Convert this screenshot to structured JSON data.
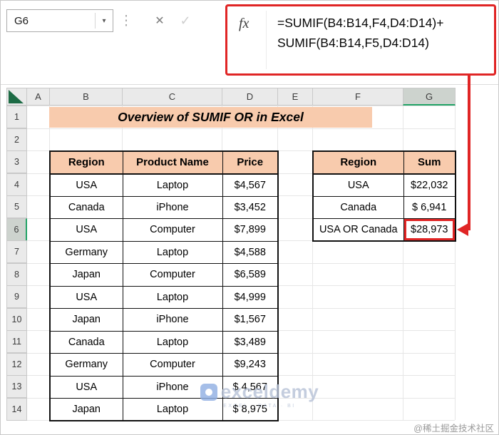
{
  "window": {
    "selected_cell": "G6"
  },
  "formula_bar": {
    "name_box_value": "G6",
    "name_box_caret": "▾",
    "handle_icon": "⋮",
    "cancel_icon": "✕",
    "enter_icon": "✓",
    "fx_label": "fx",
    "formula_line1": "=SUMIF(B4:B14,F4,D4:D14)+",
    "formula_line2": "SUMIF(B4:B14,F5,D4:D14)"
  },
  "grid": {
    "columns": [
      "A",
      "B",
      "C",
      "D",
      "E",
      "F",
      "G"
    ],
    "rows": [
      "1",
      "2",
      "3",
      "4",
      "5",
      "6",
      "7",
      "8",
      "9",
      "10",
      "11",
      "12",
      "13",
      "14"
    ]
  },
  "title_banner": "Overview of SUMIF OR in Excel",
  "source_table": {
    "headers": [
      "Region",
      "Product Name",
      "Price"
    ],
    "rows": [
      [
        "USA",
        "Laptop",
        "$4,567"
      ],
      [
        "Canada",
        "iPhone",
        "$3,452"
      ],
      [
        "USA",
        "Computer",
        "$7,899"
      ],
      [
        "Germany",
        "Laptop",
        "$4,588"
      ],
      [
        "Japan",
        "Computer",
        "$6,589"
      ],
      [
        "USA",
        "Laptop",
        "$4,999"
      ],
      [
        "Japan",
        "iPhone",
        "$1,567"
      ],
      [
        "Canada",
        "Laptop",
        "$3,489"
      ],
      [
        "Germany",
        "Computer",
        "$9,243"
      ],
      [
        "USA",
        "iPhone",
        "$ 4,567"
      ],
      [
        "Japan",
        "Laptop",
        "$ 8,975"
      ]
    ]
  },
  "result_table": {
    "headers": [
      "Region",
      "Sum"
    ],
    "rows": [
      [
        "USA",
        "$22,032"
      ],
      [
        "Canada",
        "$ 6,941"
      ],
      [
        "USA OR Canada",
        "$28,973"
      ]
    ]
  },
  "watermark": {
    "name": "exceldemy",
    "tagline": "EXCEL · DATA · BI"
  },
  "credit": "@稀土掘金技术社区",
  "colors": {
    "peach": "#F8CBAD",
    "annotation_red": "#E02525",
    "header_gray": "#EAEAEA",
    "selected_header": "#CDD3CE",
    "excel_green": "#1D6B45"
  }
}
